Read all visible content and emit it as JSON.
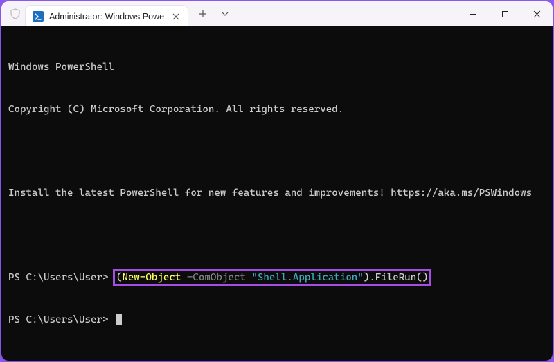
{
  "window": {
    "tab": {
      "title": "Administrator: Windows Powe",
      "icon_name": "powershell-icon"
    },
    "controls": {
      "minimize": "−",
      "maximize": "□",
      "close": "×"
    }
  },
  "terminal": {
    "header_line1": "Windows PowerShell",
    "header_line2": "Copyright (C) Microsoft Corporation. All rights reserved.",
    "install_msg": "Install the latest PowerShell for new features and improvements! https://aka.ms/PSWindows",
    "prompt1": "PS C:\\Users\\User> ",
    "command": {
      "open_paren": "(",
      "cmd": "New-Object",
      "space1": " ",
      "param": "-ComObject",
      "space2": " ",
      "string": "\"Shell.Application\"",
      "close_paren": ")",
      "method": ".FileRun()"
    },
    "prompt2": "PS C:\\Users\\User> "
  }
}
